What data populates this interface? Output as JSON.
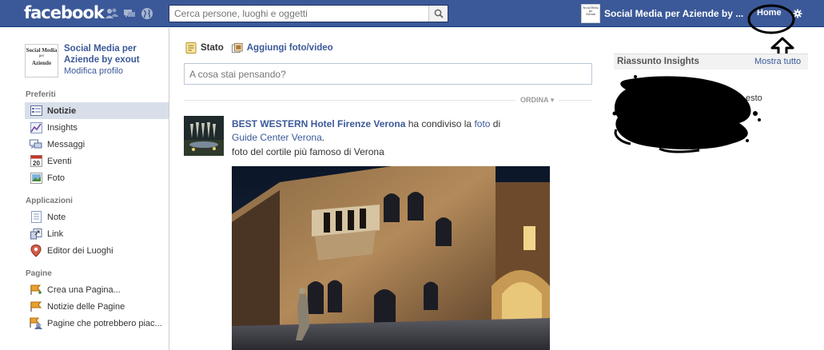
{
  "topbar": {
    "logo": "facebook",
    "search_placeholder": "Cerca persone, luoghi e oggetti",
    "page_thumb_lines": [
      "Social Media",
      "per",
      "Aziende"
    ],
    "page_name": "Social Media per Aziende by ...",
    "home_label": "Home"
  },
  "profile": {
    "thumb_lines": [
      "Social Media",
      "per",
      "Aziende"
    ],
    "name": "Social Media per Aziende by exout",
    "edit_label": "Modifica profilo"
  },
  "sidebar": {
    "favorites_header": "Preferiti",
    "favorites": [
      {
        "label": "Notizie",
        "icon": "news-feed-icon",
        "active": true
      },
      {
        "label": "Insights",
        "icon": "insights-icon"
      },
      {
        "label": "Messaggi",
        "icon": "messages-icon"
      },
      {
        "label": "Eventi",
        "icon": "events-icon",
        "badge": "20"
      },
      {
        "label": "Foto",
        "icon": "photos-icon"
      }
    ],
    "apps_header": "Applicazioni",
    "apps": [
      {
        "label": "Note",
        "icon": "notes-icon"
      },
      {
        "label": "Link",
        "icon": "link-icon"
      },
      {
        "label": "Editor dei Luoghi",
        "icon": "places-editor-icon"
      }
    ],
    "pages_header": "Pagine",
    "pages": [
      {
        "label": "Crea una Pagina...",
        "icon": "create-page-icon"
      },
      {
        "label": "Notizie delle Pagine",
        "icon": "pages-feed-icon"
      },
      {
        "label": "Pagine che potrebbero piac...",
        "icon": "suggested-pages-icon"
      }
    ]
  },
  "composer": {
    "tab_status": "Stato",
    "tab_photo": "Aggiungi foto/video",
    "placeholder": "A cosa stai pensando?"
  },
  "feed": {
    "sort_label": "ORDINA",
    "story": {
      "actor": "BEST WESTERN Hotel Firenze Verona",
      "verb": " ha condiviso la ",
      "object": "foto",
      "preposition": " di",
      "source": "Guide Center Verona",
      "source_suffix": ".",
      "caption": "foto del cortile più famoso di Verona"
    }
  },
  "insights": {
    "title": "Riassunto Insights",
    "show_all": "Mostra tutto",
    "peek_text": "esto"
  },
  "colors": {
    "brand_blue": "#3b5998",
    "active_nav": "#d8dfea"
  }
}
